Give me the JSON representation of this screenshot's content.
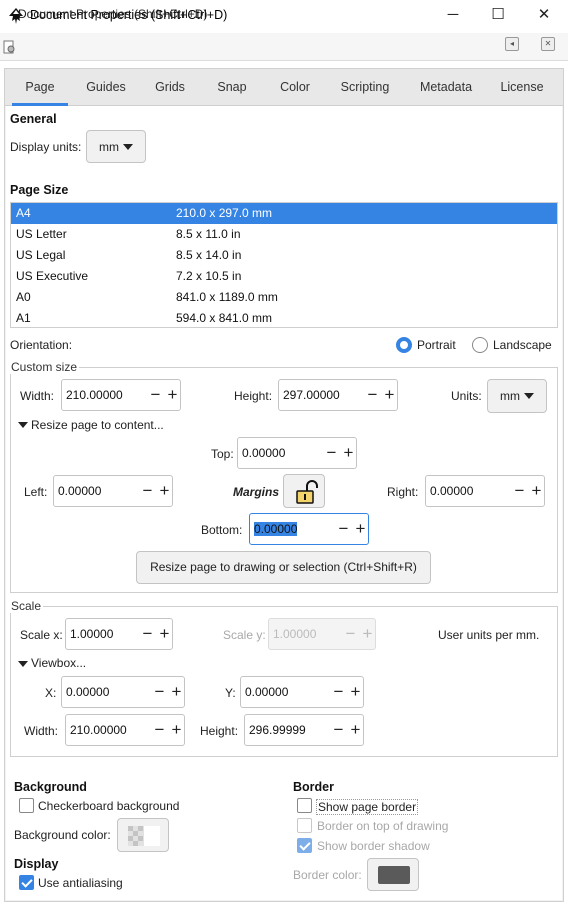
{
  "window": {
    "title": "Document Properties (Shift+Ctrl+D)",
    "minimize": "─",
    "maximize": "☐",
    "close": "✕"
  },
  "dock": {
    "title": "Document Properties (Shift+Ctrl+D)",
    "iconify": "◂",
    "close": "✕"
  },
  "tabs": [
    "Page",
    "Guides",
    "Grids",
    "Snap",
    "Color",
    "Scripting",
    "Metadata",
    "License"
  ],
  "active_tab": "Page",
  "general": {
    "heading": "General",
    "display_units_label": "Display units:",
    "display_units_value": "mm"
  },
  "page_size": {
    "heading": "Page Size",
    "rows": [
      {
        "name": "A4",
        "size": "210.0 x 297.0 mm",
        "selected": true
      },
      {
        "name": "US Letter",
        "size": "8.5 x 11.0 in"
      },
      {
        "name": "US Legal",
        "size": "8.5 x 14.0 in"
      },
      {
        "name": "US Executive",
        "size": "7.2 x 10.5 in"
      },
      {
        "name": "A0",
        "size": "841.0 x 1189.0 mm"
      },
      {
        "name": "A1",
        "size": "594.0 x 841.0 mm"
      }
    ]
  },
  "orientation": {
    "label": "Orientation:",
    "portrait": "Portrait",
    "landscape": "Landscape",
    "selected": "Portrait"
  },
  "custom_size": {
    "heading": "Custom size",
    "width_label": "Width:",
    "width": "210.00000",
    "height_label": "Height:",
    "height": "297.00000",
    "units_label": "Units:",
    "units": "mm",
    "resize_expander": "Resize page to content...",
    "top_label": "Top:",
    "top": "0.00000",
    "left_label": "Left:",
    "left": "0.00000",
    "margins_label": "Margins",
    "right_label": "Right:",
    "right": "0.00000",
    "bottom_label": "Bottom:",
    "bottom": "0.00000",
    "resize_button": "Resize page to drawing or selection (Ctrl+Shift+R)"
  },
  "scale": {
    "heading": "Scale",
    "scale_x_label": "Scale x:",
    "scale_x": "1.00000",
    "scale_y_label": "Scale y:",
    "scale_y": "1.00000",
    "units_text": "User units per mm.",
    "viewbox_expander": "Viewbox...",
    "x_label": "X:",
    "x": "0.00000",
    "y_label": "Y:",
    "y": "0.00000",
    "width_label": "Width:",
    "width": "210.00000",
    "height_label": "Height:",
    "height": "296.99999"
  },
  "background": {
    "heading": "Background",
    "checkerboard_label": "Checkerboard background",
    "checkerboard_checked": false,
    "color_label": "Background color:"
  },
  "display": {
    "heading": "Display",
    "antialias_label": "Use antialiasing",
    "antialias_checked": true
  },
  "border": {
    "heading": "Border",
    "show_border_label": "Show page border",
    "border_on_top_label": "Border on top of drawing",
    "show_shadow_label": "Show border shadow",
    "color_label": "Border color:",
    "color": "#5a5a5a"
  },
  "colors": {
    "accent": "#3584e4"
  }
}
